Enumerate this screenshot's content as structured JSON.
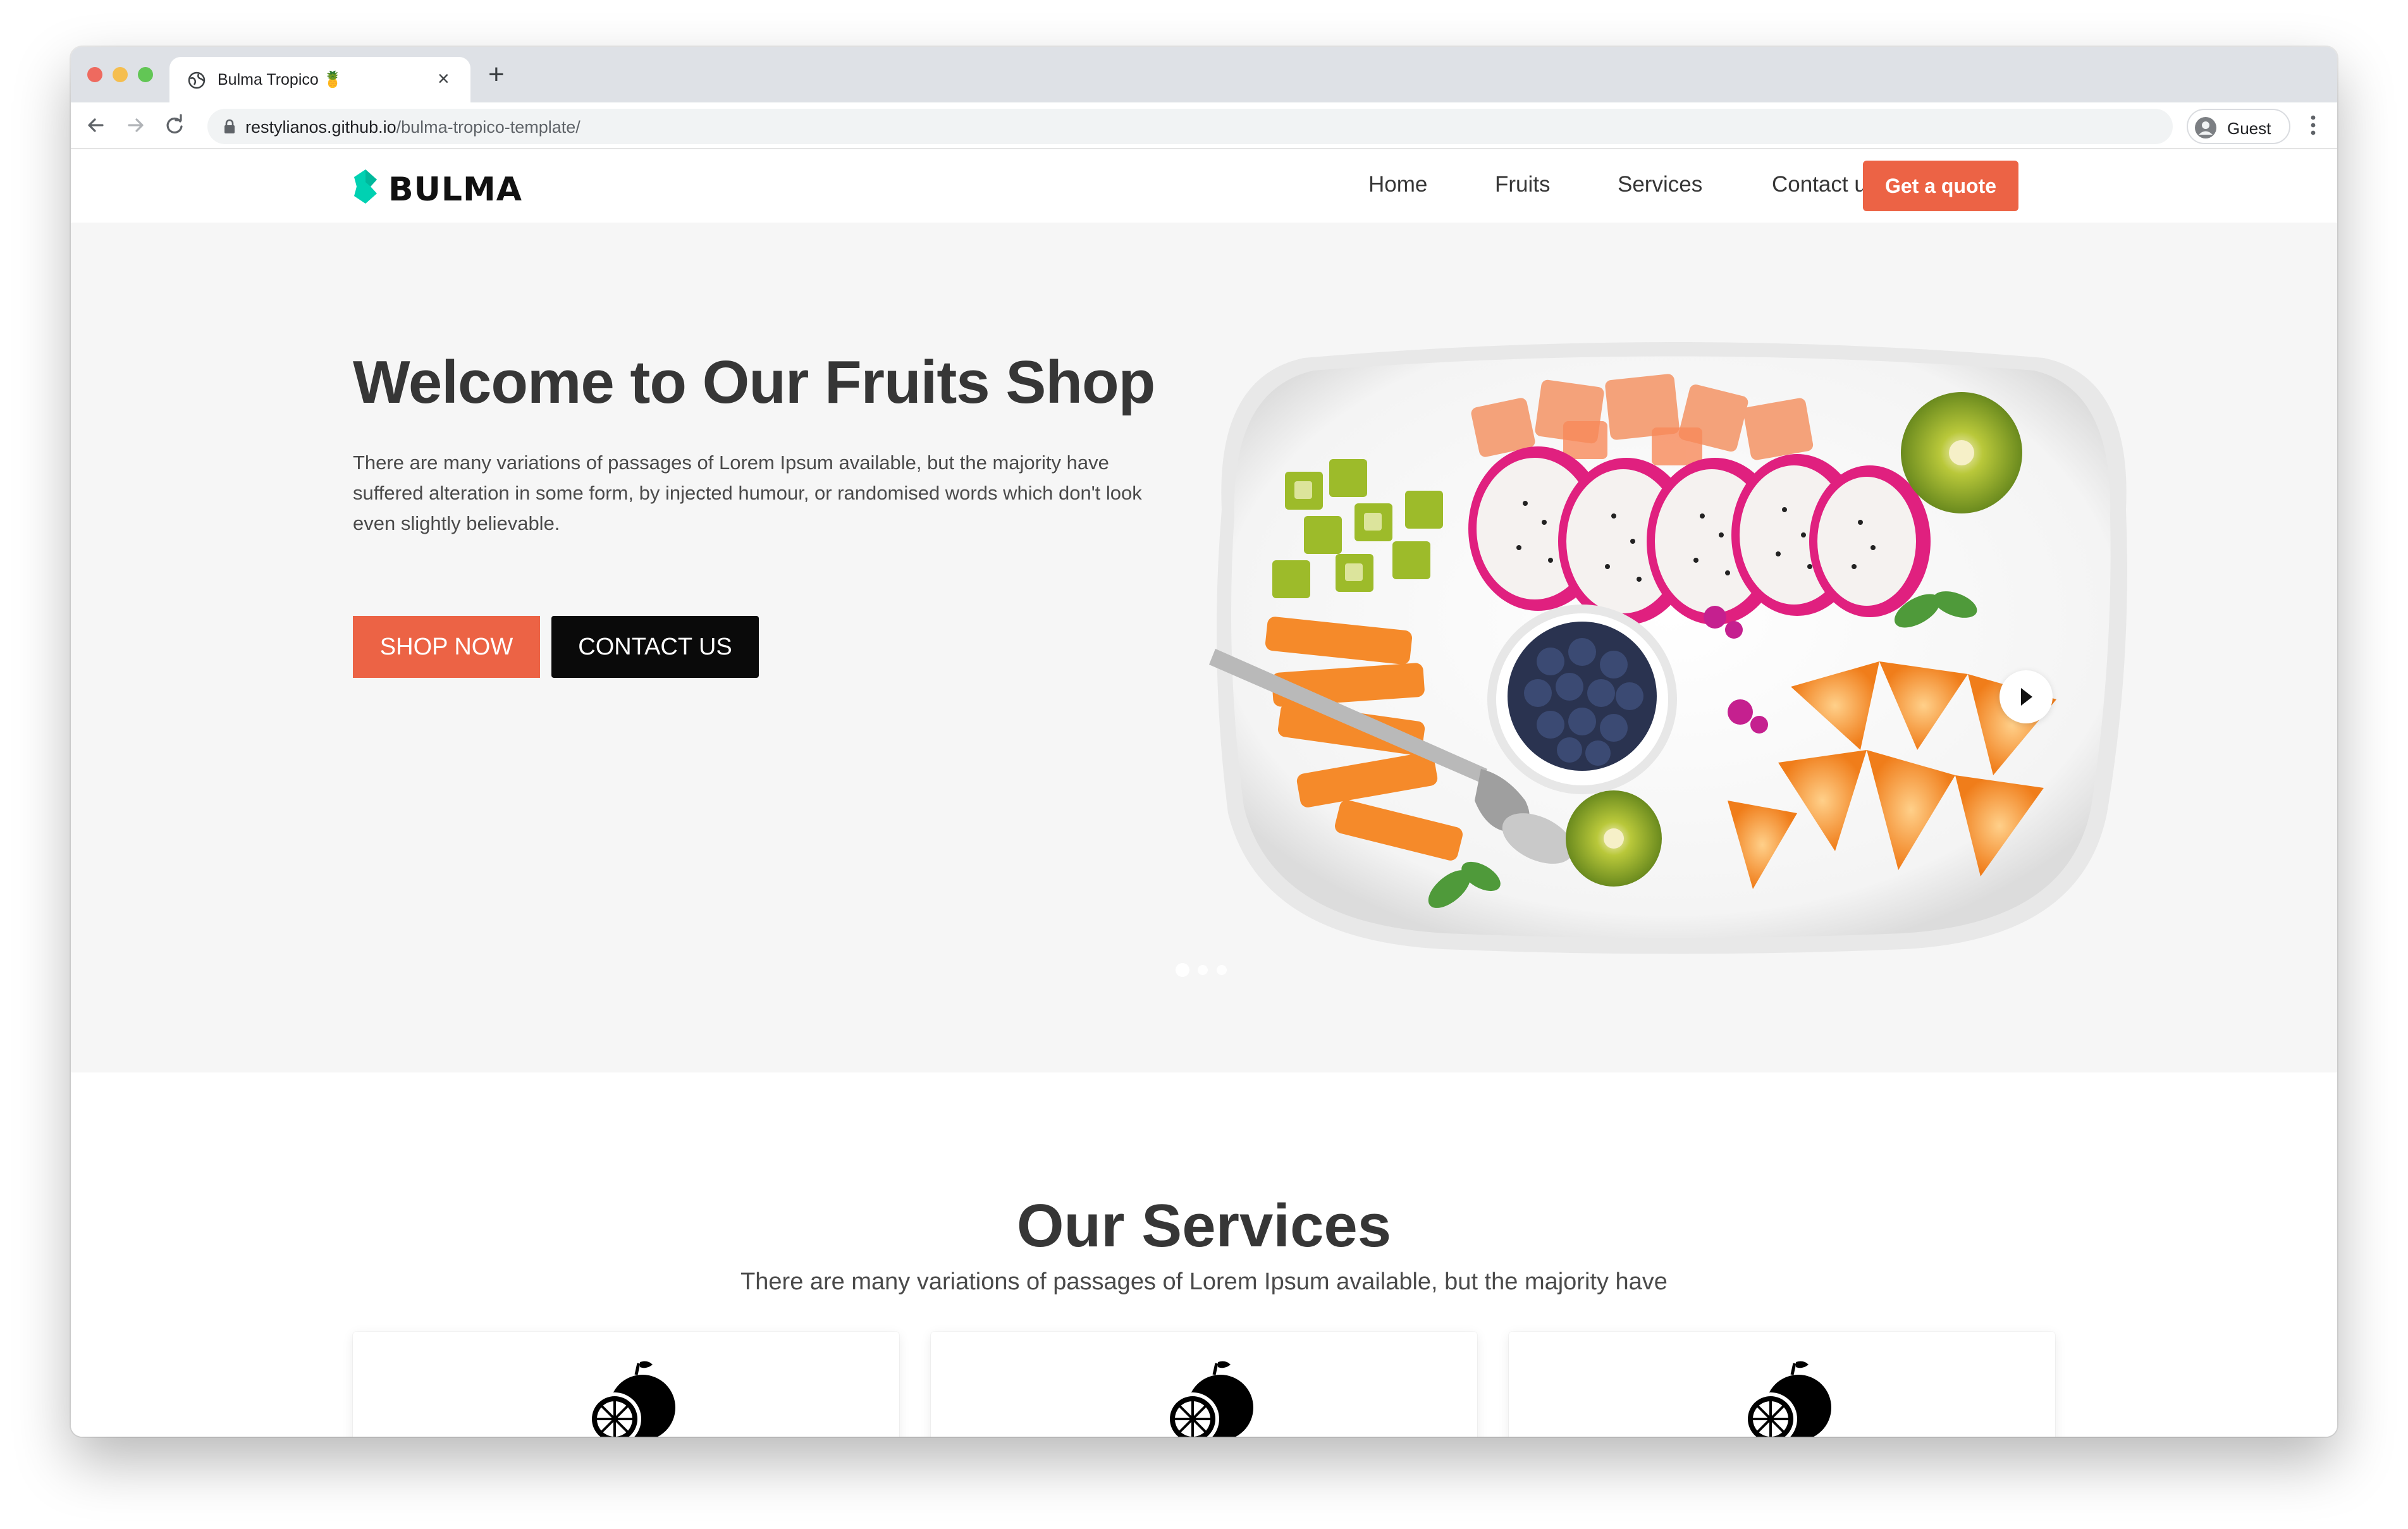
{
  "browser": {
    "tab_title": "Bulma Tropico 🍍",
    "tab_close": "×",
    "new_tab": "+",
    "url_host": "restylianos.github.io",
    "url_path": "/bulma-tropico-template/",
    "profile_label": "Guest"
  },
  "navbar": {
    "brand": "BULMA",
    "links": [
      "Home",
      "Fruits",
      "Services",
      "Contact us"
    ],
    "cta": "Get a quote"
  },
  "hero": {
    "title": "Welcome to Our Fruits Shop",
    "text": "There are many variations of passages of Lorem Ipsum available, but the majority have suffered alteration in some form, by injected humour, or randomised words which don't look even slightly believable.",
    "primary_button": "SHOP NOW",
    "secondary_button": "CONTACT US",
    "carousel": {
      "slides": 3,
      "active_slide": 1,
      "image": "fruit-platter-image"
    }
  },
  "services": {
    "title": "Our Services",
    "subtitle": "There are many variations of passages of Lorem Ipsum available, but the majority have",
    "cards": [
      {
        "icon": "fruit-icon"
      },
      {
        "icon": "fruit-icon"
      },
      {
        "icon": "fruit-icon"
      }
    ]
  },
  "colors": {
    "accent": "#ec6345",
    "dark_button": "#0a0a0a",
    "hero_bg": "#f6f6f6",
    "brand_teal": "#00d1b2",
    "text": "#363636"
  }
}
